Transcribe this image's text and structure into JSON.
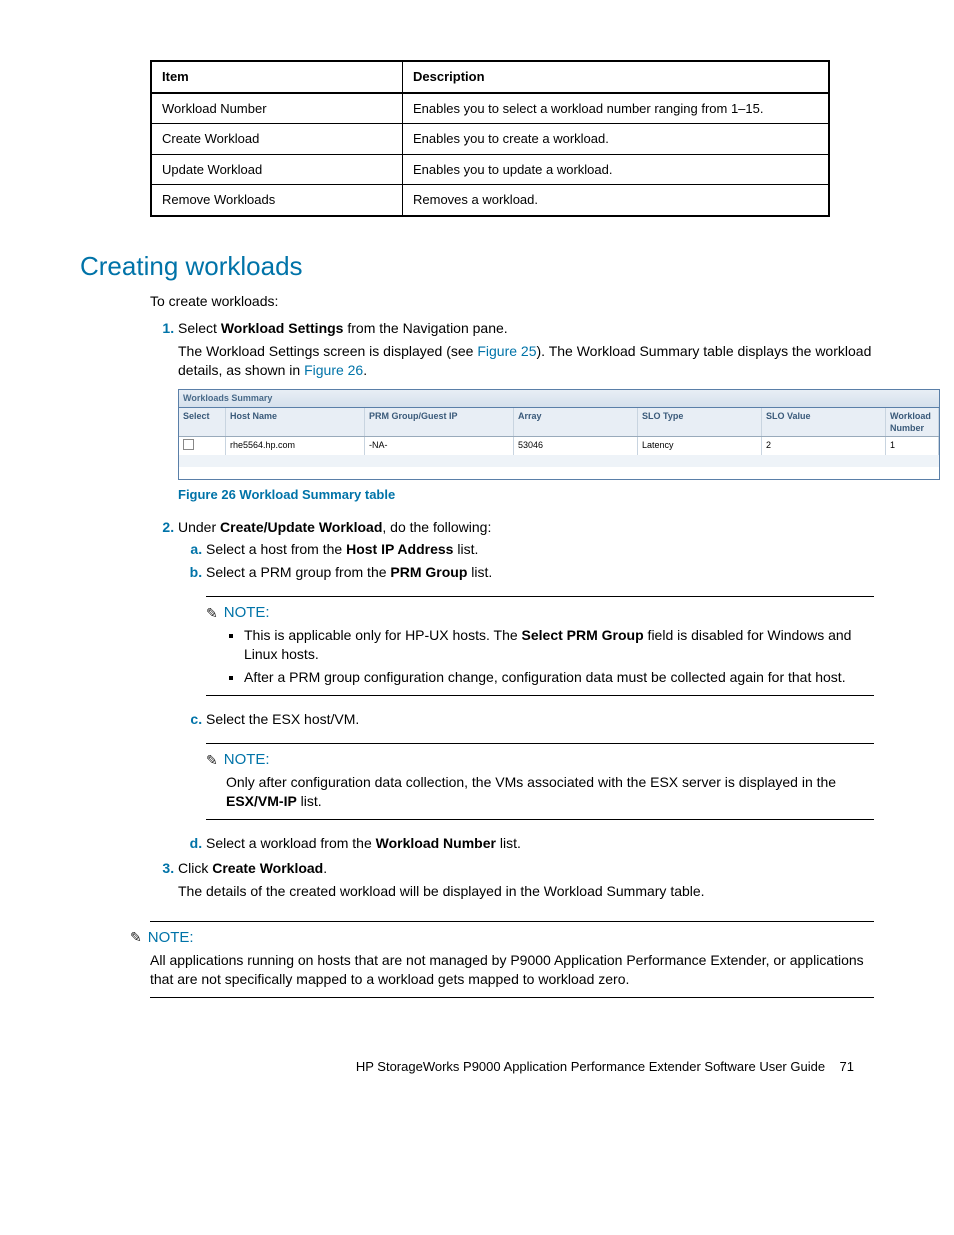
{
  "defTable": {
    "headers": {
      "item": "Item",
      "desc": "Description"
    },
    "rows": [
      {
        "item": "Workload Number",
        "desc": "Enables you to select a workload number ranging from 1–15."
      },
      {
        "item": "Create Workload",
        "desc": "Enables you to create a workload."
      },
      {
        "item": "Update Workload",
        "desc": "Enables you to update a workload."
      },
      {
        "item": "Remove Workloads",
        "desc": "Removes a workload."
      }
    ]
  },
  "sectionTitle": "Creating workloads",
  "intro": "To create workloads:",
  "step1": {
    "prefix": "Select ",
    "bold": "Workload Settings",
    "suffix": " from the Navigation pane.",
    "line2a": "The Workload Settings screen is displayed (see ",
    "fig25": "Figure 25",
    "line2b": "). The Workload Summary table displays the workload details, as shown in ",
    "fig26": "Figure 26",
    "line2c": "."
  },
  "summary": {
    "title": "Workloads Summary",
    "headers": {
      "select": "Select",
      "host": "Host Name",
      "prm": "PRM Group/Guest IP",
      "array": "Array",
      "slot": "SLO Type",
      "slov": "SLO Value",
      "wn": "Workload Number"
    },
    "row": {
      "host": "rhe5564.hp.com",
      "prm": "-NA-",
      "array": "53046",
      "slot": "Latency",
      "slov": "2",
      "wn": "1"
    }
  },
  "figureCaption": "Figure 26 Workload Summary table",
  "step2": {
    "prefix": "Under ",
    "bold": "Create/Update Workload",
    "suffix": ", do the following:",
    "a": {
      "t1": "Select a host from the ",
      "b": "Host IP Address",
      "t2": " list."
    },
    "b": {
      "t1": "Select a PRM group from the ",
      "b": "PRM Group",
      "t2": " list."
    },
    "c": "Select the ESX host/VM.",
    "d": {
      "t1": "Select a workload from the ",
      "b": "Workload Number",
      "t2": " list."
    }
  },
  "noteLabel": "NOTE:",
  "note1": {
    "b1a": "This is applicable only for HP-UX hosts. The ",
    "b1b": "Select PRM Group",
    "b1c": " field is disabled for Windows and Linux hosts.",
    "b2": "After a PRM group configuration change, configuration data must be collected again for that host."
  },
  "note2": {
    "t1": "Only after configuration data collection, the VMs associated with the ESX server is displayed in the ",
    "b": "ESX/VM-IP",
    "t2": " list."
  },
  "step3": {
    "prefix": "Click ",
    "bold": "Create Workload",
    "suffix": ".",
    "line2": "The details of the created workload will be displayed in the Workload Summary table."
  },
  "note3": "All applications running on hosts that are not managed by P9000 Application Performance Extender, or applications that are not specifically mapped to a workload gets mapped to workload zero.",
  "footer": {
    "title": "HP StorageWorks P9000 Application Performance Extender Software User Guide",
    "page": "71"
  }
}
